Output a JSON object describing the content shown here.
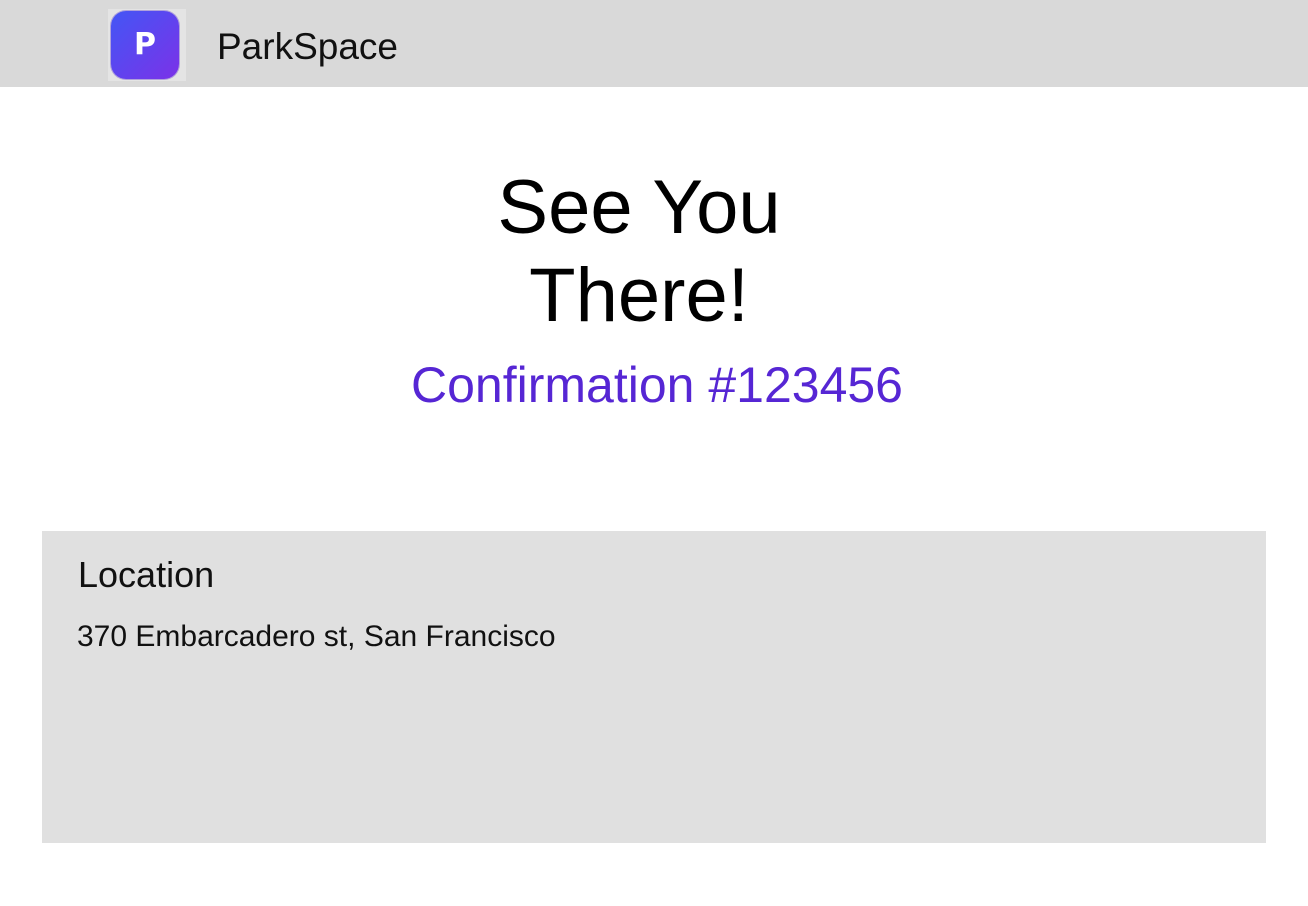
{
  "header": {
    "logo_letter": "P",
    "brand_name": "ParkSpace"
  },
  "hero": {
    "title_line1": "See You",
    "title_line2": "There!",
    "confirmation": "Confirmation #123456"
  },
  "location": {
    "heading": "Location",
    "address": "370 Embarcadero st, San Francisco"
  },
  "colors": {
    "header_bg": "#d9d9d9",
    "accent": "#5626d4",
    "logo_gradient_start": "#4356f5",
    "logo_gradient_end": "#7b32e8",
    "card_bg": "#e0e0e0"
  },
  "icons": {
    "logo": "parkspace-logo-icon"
  }
}
